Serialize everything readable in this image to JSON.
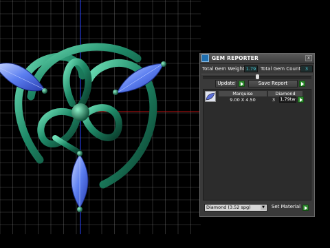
{
  "panel": {
    "title": "GEM REPORTER",
    "close_glyph": "x",
    "total_gem_weight_label": "Total Gem Weight",
    "total_gem_weight_value": "1.79",
    "total_gem_count_label": "Total Gem Count",
    "total_gem_count_value": "3",
    "update_label": "Update",
    "save_report_label": "Save Report",
    "list": {
      "headers": [
        "Marquise",
        "Diamond"
      ],
      "row": {
        "size": "9.00 X 4.50",
        "count": "3",
        "weight": "1.79tw"
      }
    },
    "material_select_value": "Diamond (3.52 spg)",
    "set_material_label": "Set Material"
  },
  "icons": {
    "logo": "gem-reporter-logo-icon",
    "close": "close-icon",
    "go": "green-arrow-icon",
    "gem": "marquise-gem-icon",
    "dropdown": "chevron-down-icon"
  },
  "colors": {
    "background": "#000000",
    "grid": "#8a8a8a",
    "metal": "#1f8a68",
    "gem": "#5b7ef0",
    "panel": "#3a3a3a",
    "value_text": "#4fd0e0",
    "go_button": "#2e8b2e"
  }
}
